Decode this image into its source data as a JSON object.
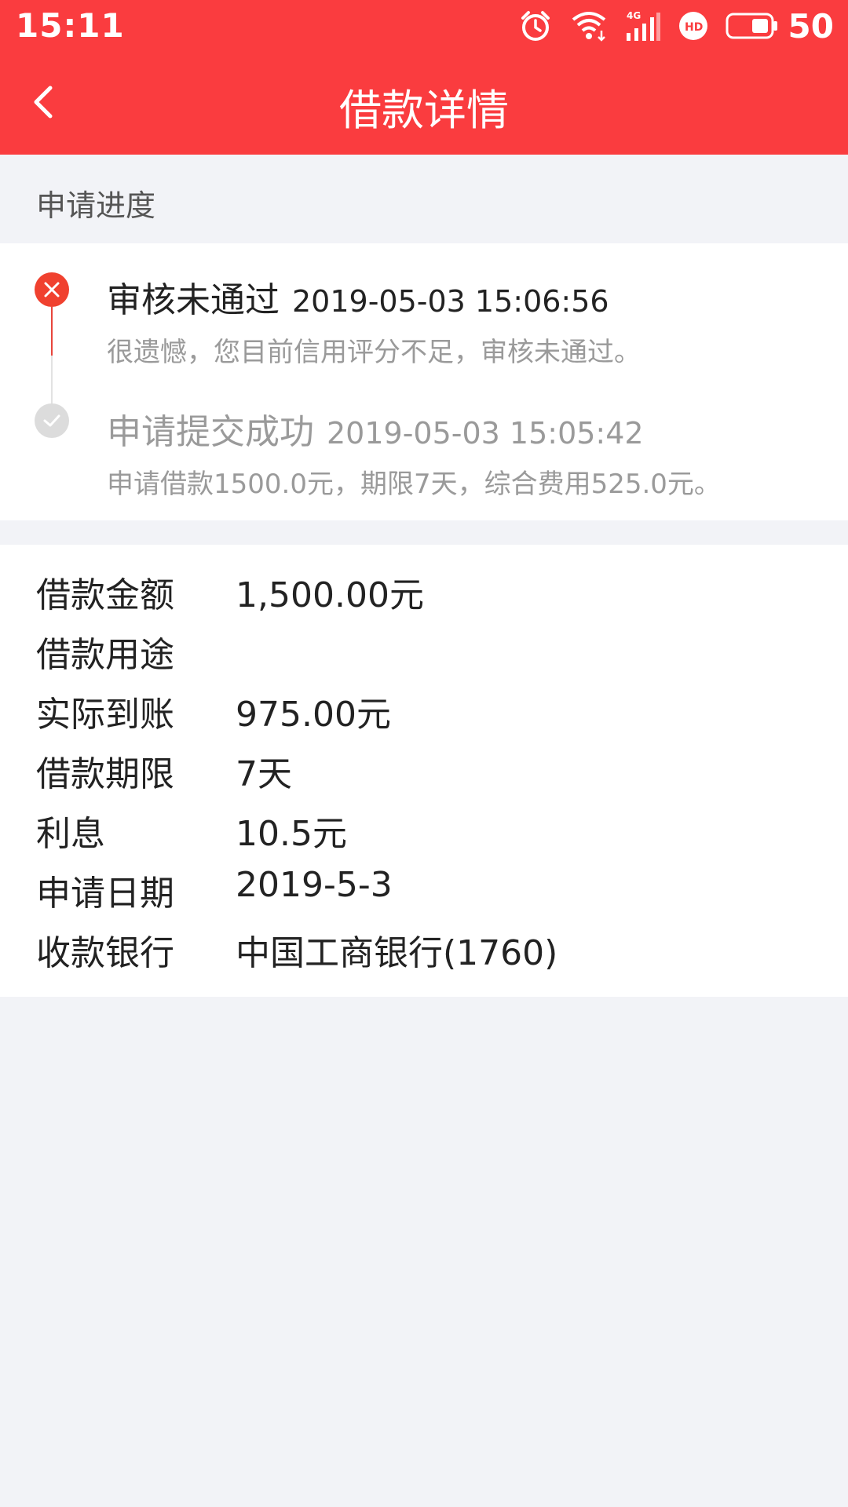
{
  "status_bar": {
    "time": "15:11",
    "battery": "50",
    "icons": [
      "alarm-icon",
      "wifi-icon",
      "signal-4g-icon",
      "hd-icon",
      "battery-icon"
    ]
  },
  "nav": {
    "back_icon": "chevron-left-icon",
    "title": "借款详情"
  },
  "progress_section": {
    "label": "申请进度"
  },
  "timeline": [
    {
      "status": "审核未通过",
      "time": "2019-05-03 15:06:56",
      "description": "很遗憾，您目前信用评分不足，审核未通过。",
      "icon": "close-icon"
    },
    {
      "status": "申请提交成功",
      "time": "2019-05-03 15:05:42",
      "description": "申请借款1500.0元，期限7天，综合费用525.0元。",
      "icon": "check-icon"
    }
  ],
  "details": [
    {
      "label": "借款金额",
      "value": "1,500.00元"
    },
    {
      "label": "借款用途",
      "value": ""
    },
    {
      "label": "实际到账",
      "value": "975.00元"
    },
    {
      "label": "借款期限",
      "value": "7天"
    },
    {
      "label": "利息",
      "value": "10.5元"
    },
    {
      "label": "申请日期",
      "value": "2019-5-3"
    },
    {
      "label": "收款银行",
      "value": "中国工商银行(1760)"
    }
  ],
  "colors": {
    "brand": "#fa3c3f",
    "fail": "#f0412f",
    "muted": "#9a9a9a",
    "background": "#f2f3f7"
  }
}
